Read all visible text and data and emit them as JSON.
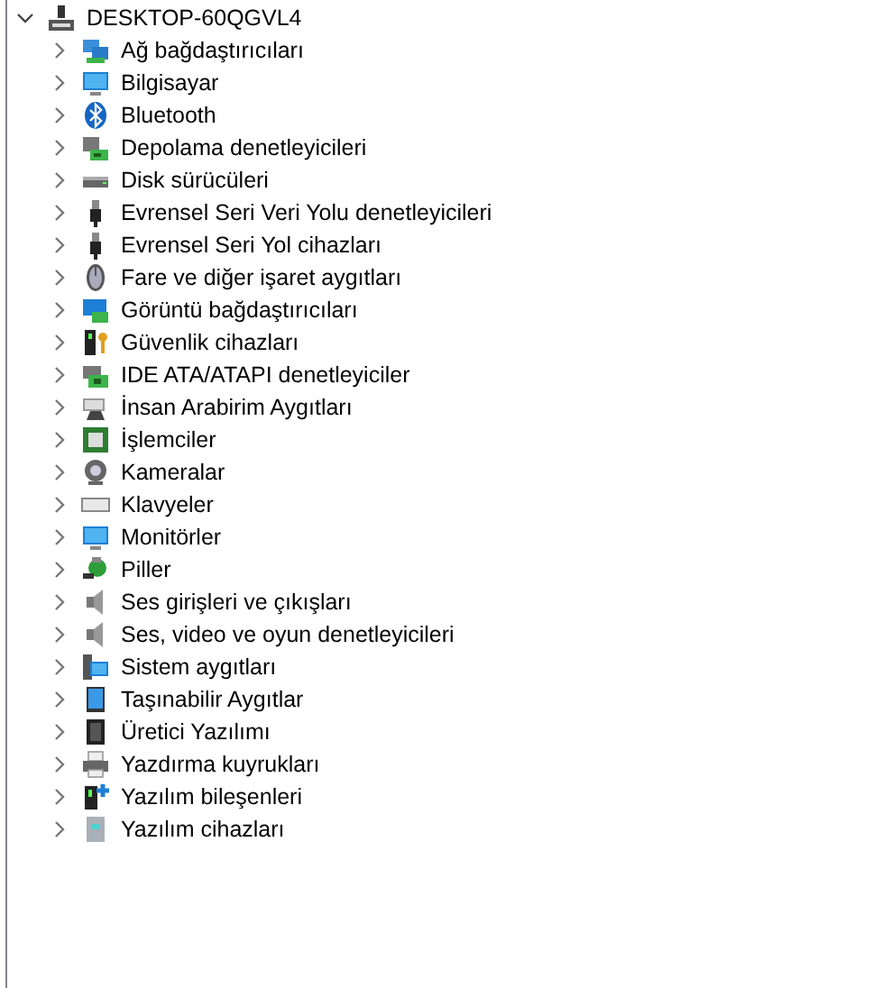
{
  "tree": {
    "label": "DESKTOP-60QGVL4",
    "kind": "computer",
    "expanded": true,
    "children": [
      {
        "label": "Ağ bağdaştırıcıları",
        "kind": "network",
        "expanded": false
      },
      {
        "label": "Bilgisayar",
        "kind": "monitor",
        "expanded": false
      },
      {
        "label": "Bluetooth",
        "kind": "bluetooth",
        "expanded": false
      },
      {
        "label": "Depolama denetleyicileri",
        "kind": "storage",
        "expanded": false
      },
      {
        "label": "Disk sürücüleri",
        "kind": "disk",
        "expanded": false
      },
      {
        "label": "Evrensel Seri Veri Yolu denetleyicileri",
        "kind": "usb",
        "expanded": false
      },
      {
        "label": "Evrensel Seri Yol cihazları",
        "kind": "usb",
        "expanded": false
      },
      {
        "label": "Fare ve diğer işaret aygıtları",
        "kind": "mouse",
        "expanded": false
      },
      {
        "label": "Görüntü bağdaştırıcıları",
        "kind": "display",
        "expanded": false
      },
      {
        "label": "Güvenlik cihazları",
        "kind": "security",
        "expanded": false
      },
      {
        "label": "IDE ATA/ATAPI denetleyiciler",
        "kind": "ide",
        "expanded": false
      },
      {
        "label": "İnsan Arabirim Aygıtları",
        "kind": "hid",
        "expanded": false
      },
      {
        "label": "İşlemciler",
        "kind": "cpu",
        "expanded": false
      },
      {
        "label": "Kameralar",
        "kind": "camera",
        "expanded": false
      },
      {
        "label": "Klavyeler",
        "kind": "keyboard",
        "expanded": false
      },
      {
        "label": "Monitörler",
        "kind": "monitor",
        "expanded": false
      },
      {
        "label": "Piller",
        "kind": "battery",
        "expanded": false
      },
      {
        "label": "Ses girişleri ve çıkışları",
        "kind": "speaker",
        "expanded": false
      },
      {
        "label": "Ses, video ve oyun denetleyicileri",
        "kind": "speaker",
        "expanded": false
      },
      {
        "label": "Sistem aygıtları",
        "kind": "system",
        "expanded": false
      },
      {
        "label": "Taşınabilir Aygıtlar",
        "kind": "portable",
        "expanded": false
      },
      {
        "label": "Üretici Yazılımı",
        "kind": "chip",
        "expanded": false
      },
      {
        "label": "Yazdırma kuyrukları",
        "kind": "printer",
        "expanded": false
      },
      {
        "label": "Yazılım bileşenleri",
        "kind": "component",
        "expanded": false
      },
      {
        "label": "Yazılım cihazları",
        "kind": "tower",
        "expanded": false
      }
    ]
  }
}
